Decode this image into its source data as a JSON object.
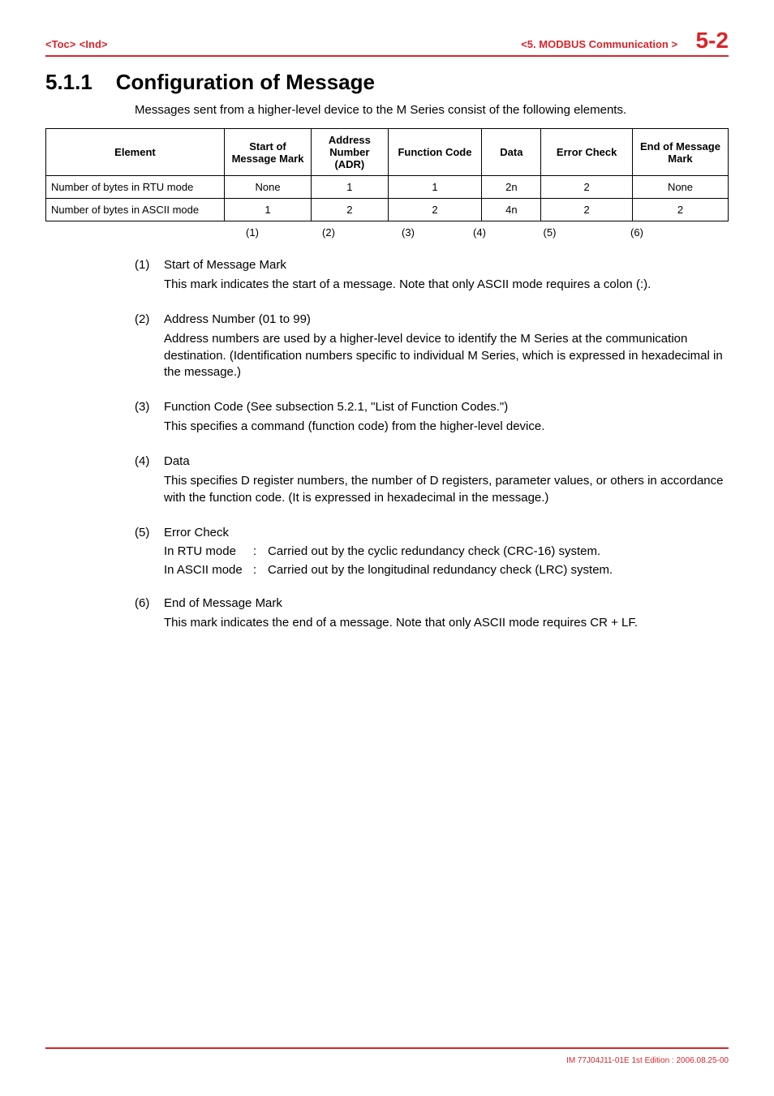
{
  "header": {
    "toc": "<Toc>",
    "ind": "<Ind>",
    "chapter": "<5.  MODBUS Communication >",
    "page_number": "5-2"
  },
  "section": {
    "number": "5.1.1",
    "title": "Configuration of Message",
    "intro": "Messages sent from a higher-level device to the M Series consist of the following elements."
  },
  "table": {
    "headers": [
      "Element",
      "Start of Message Mark",
      "Address Number (ADR)",
      "Function Code",
      "Data",
      "Error Check",
      "End of Message Mark"
    ],
    "rows": [
      {
        "label": "Number of bytes in RTU mode",
        "cells": [
          "None",
          "1",
          "1",
          "2n",
          "2",
          "None"
        ]
      },
      {
        "label": "Number of bytes in ASCII mode",
        "cells": [
          "1",
          "2",
          "2",
          "4n",
          "2",
          "2"
        ]
      }
    ],
    "index_row": [
      "(1)",
      "(2)",
      "(3)",
      "(4)",
      "(5)",
      "(6)"
    ]
  },
  "items": [
    {
      "num": "(1)",
      "title": "Start of Message Mark",
      "body": "This mark indicates the start of a message.  Note that only ASCII mode requires a colon (:)."
    },
    {
      "num": "(2)",
      "title": "Address Number (01 to 99)",
      "body": "Address numbers are used by a higher-level device to identify the M Series at the communication destination. (Identification numbers specific to individual M Series, which is expressed in hexadecimal in the message.)"
    },
    {
      "num": "(3)",
      "title": "Function Code (See subsection 5.2.1, \"List of Function Codes.\")",
      "body": "This specifies a command (function code) from the higher-level device."
    },
    {
      "num": "(4)",
      "title": "Data",
      "body": "This specifies D register numbers, the number of D registers, parameter values, or others in accordance with the function code. (It is expressed in hexadecimal in the message.)"
    },
    {
      "num": "(5)",
      "title": "Error Check",
      "modes": [
        {
          "label": "In RTU mode",
          "value": "Carried out by the cyclic redundancy check (CRC-16) system."
        },
        {
          "label": "In ASCII mode",
          "value": "Carried out by the longitudinal redundancy check (LRC) system."
        }
      ]
    },
    {
      "num": "(6)",
      "title": "End of Message Mark",
      "body": "This mark indicates the end of a message. Note that only ASCII mode requires CR + LF."
    }
  ],
  "footer": "IM 77J04J11-01E  1st Edition : 2006.08.25-00"
}
